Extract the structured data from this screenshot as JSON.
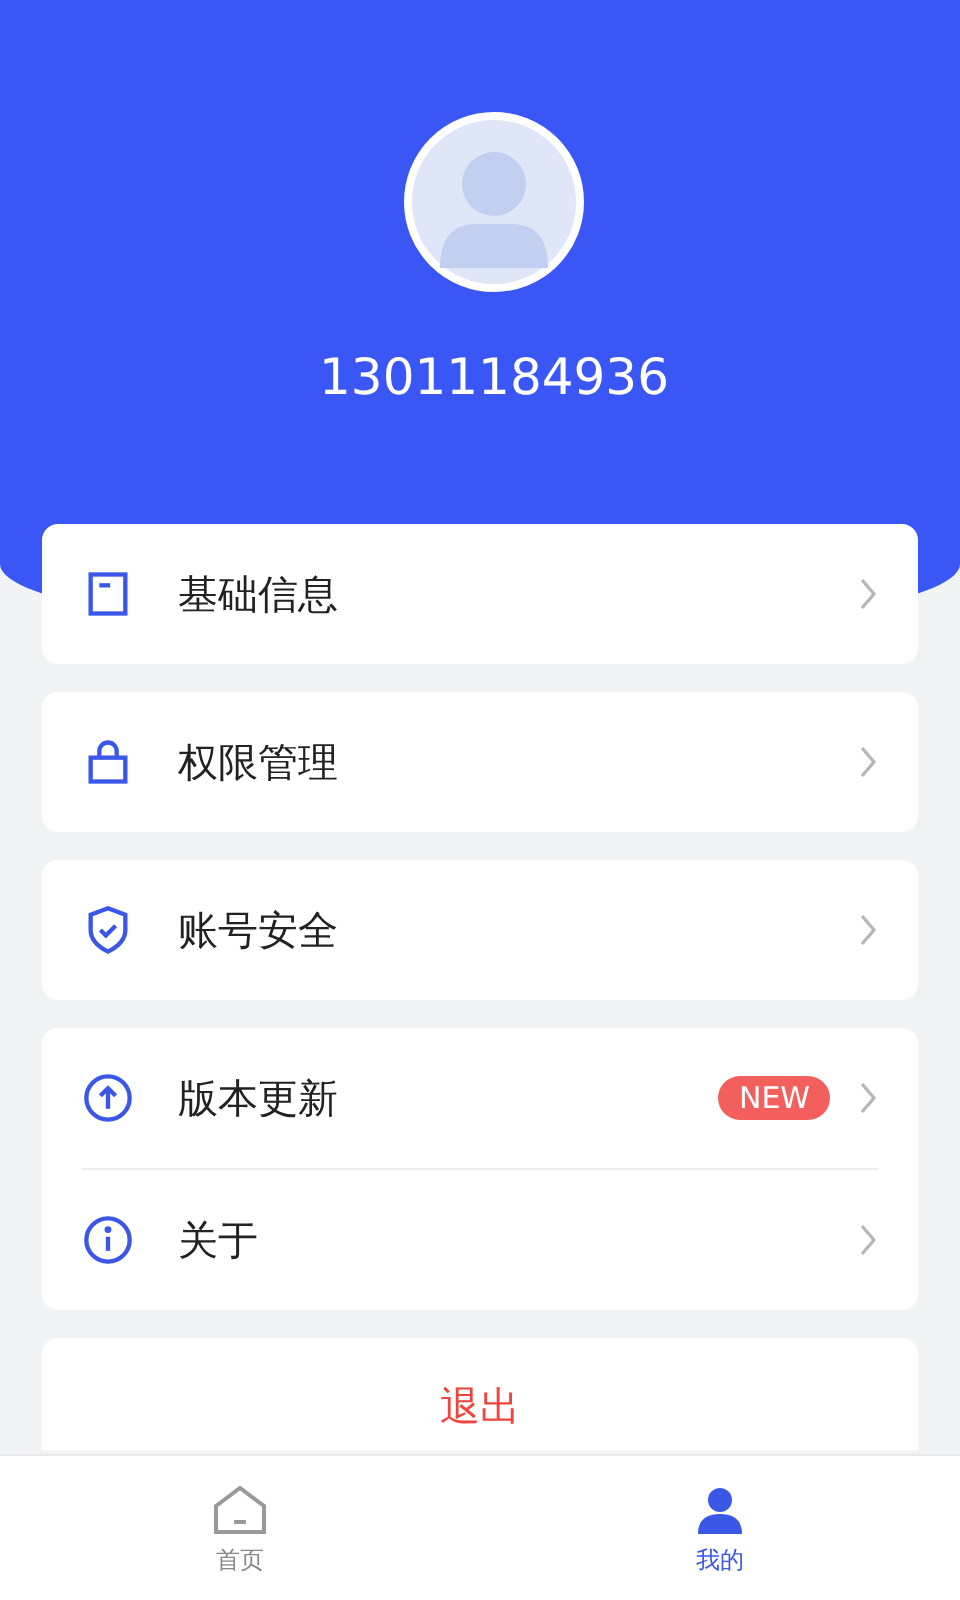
{
  "profile": {
    "phone": "13011184936"
  },
  "menu_groups": [
    {
      "items": [
        {
          "label": "基础信息"
        }
      ]
    },
    {
      "items": [
        {
          "label": "权限管理"
        }
      ]
    },
    {
      "items": [
        {
          "label": "账号安全"
        }
      ]
    },
    {
      "items": [
        {
          "label": "版本更新",
          "badge": "NEW"
        },
        {
          "label": "关于"
        }
      ]
    }
  ],
  "logout": {
    "label": "退出"
  },
  "bottom_nav": [
    {
      "label": "首页",
      "selected": false
    },
    {
      "label": "我的",
      "selected": true
    }
  ]
}
